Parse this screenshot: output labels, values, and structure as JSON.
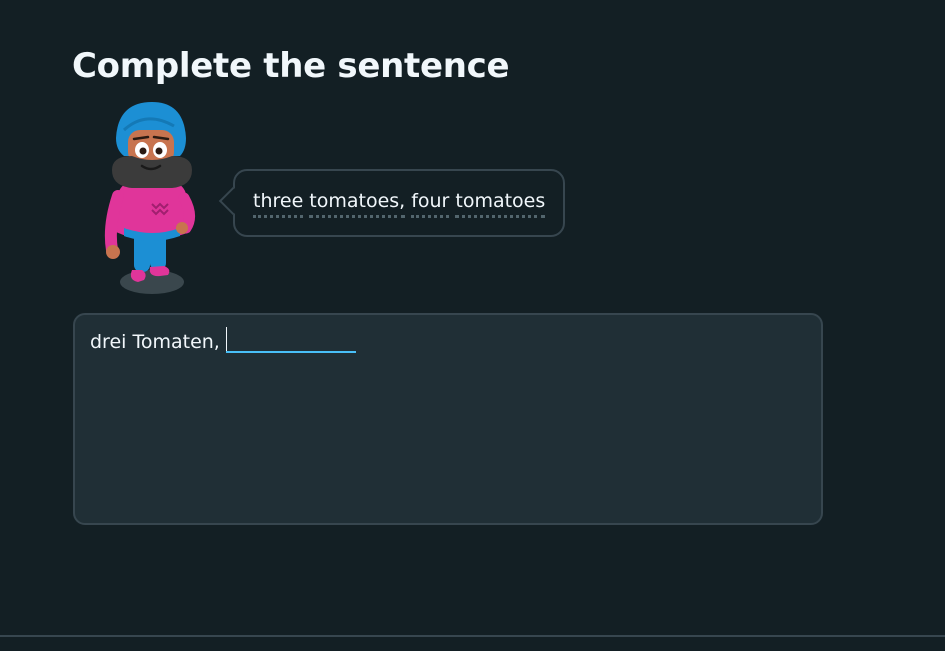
{
  "challenge": {
    "title": "Complete the sentence"
  },
  "character": {
    "icon": "character-illustration-icon"
  },
  "prompt": {
    "words": [
      "three",
      "tomatoes,",
      "four",
      "tomatoes"
    ]
  },
  "answer": {
    "prefix": "drei Tomaten,",
    "input_value": "",
    "input_placeholder": ""
  },
  "colors": {
    "background": "#131f24",
    "panel": "#202f36",
    "border": "#37464f",
    "accent": "#49c0f8",
    "text": "#f1f7fb"
  }
}
